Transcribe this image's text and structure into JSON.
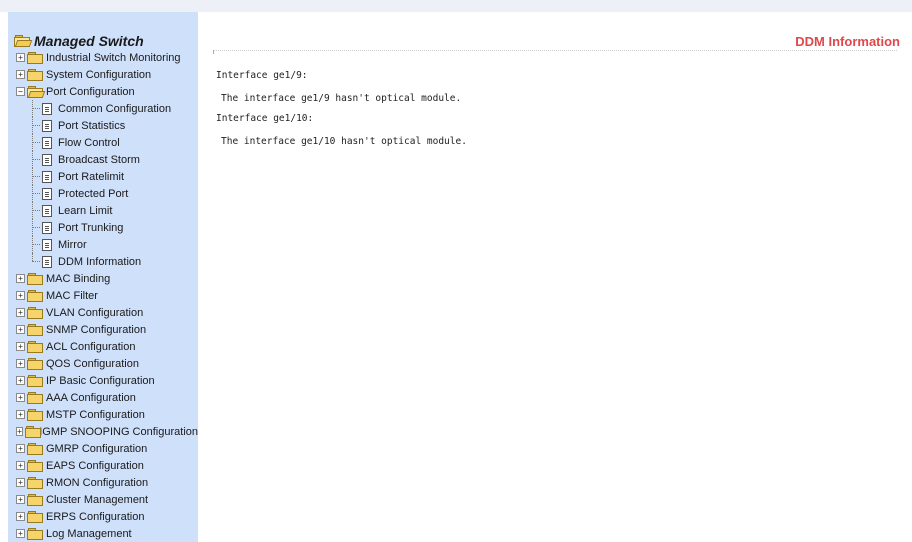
{
  "sidebar": {
    "root": "Managed Switch",
    "items": [
      {
        "label": "Industrial Switch Monitoring",
        "type": "folder",
        "expanded": false
      },
      {
        "label": "System Configuration",
        "type": "folder",
        "expanded": false
      },
      {
        "label": "Port Configuration",
        "type": "folder",
        "expanded": true,
        "children": [
          {
            "label": "Common Configuration"
          },
          {
            "label": "Port Statistics"
          },
          {
            "label": "Flow Control"
          },
          {
            "label": "Broadcast Storm"
          },
          {
            "label": "Port Ratelimit"
          },
          {
            "label": "Protected Port"
          },
          {
            "label": "Learn Limit"
          },
          {
            "label": "Port Trunking"
          },
          {
            "label": "Mirror"
          },
          {
            "label": "DDM Information"
          }
        ]
      },
      {
        "label": "MAC Binding",
        "type": "folder",
        "expanded": false
      },
      {
        "label": "MAC Filter",
        "type": "folder",
        "expanded": false
      },
      {
        "label": "VLAN Configuration",
        "type": "folder",
        "expanded": false
      },
      {
        "label": "SNMP Configuration",
        "type": "folder",
        "expanded": false
      },
      {
        "label": "ACL Configuration",
        "type": "folder",
        "expanded": false
      },
      {
        "label": "QOS Configuration",
        "type": "folder",
        "expanded": false
      },
      {
        "label": "IP Basic Configuration",
        "type": "folder",
        "expanded": false
      },
      {
        "label": "AAA Configuration",
        "type": "folder",
        "expanded": false
      },
      {
        "label": "MSTP Configuration",
        "type": "folder",
        "expanded": false
      },
      {
        "label": "IGMP SNOOPING Configuration",
        "type": "folder",
        "expanded": false
      },
      {
        "label": "GMRP Configuration",
        "type": "folder",
        "expanded": false
      },
      {
        "label": "EAPS Configuration",
        "type": "folder",
        "expanded": false
      },
      {
        "label": "RMON Configuration",
        "type": "folder",
        "expanded": false
      },
      {
        "label": "Cluster Management",
        "type": "folder",
        "expanded": false
      },
      {
        "label": "ERPS Configuration",
        "type": "folder",
        "expanded": false
      },
      {
        "label": "Log Management",
        "type": "folder",
        "expanded": false
      }
    ]
  },
  "main": {
    "title": "DDM Information",
    "interfaces": [
      {
        "heading": "Interface ge1/9:",
        "message": "The interface ge1/9 hasn't optical module."
      },
      {
        "heading": "Interface ge1/10:",
        "message": "The interface ge1/10 hasn't optical module."
      }
    ]
  },
  "colors": {
    "sidebar_bg": "#cfe0fb",
    "title_red": "#e0474a"
  }
}
